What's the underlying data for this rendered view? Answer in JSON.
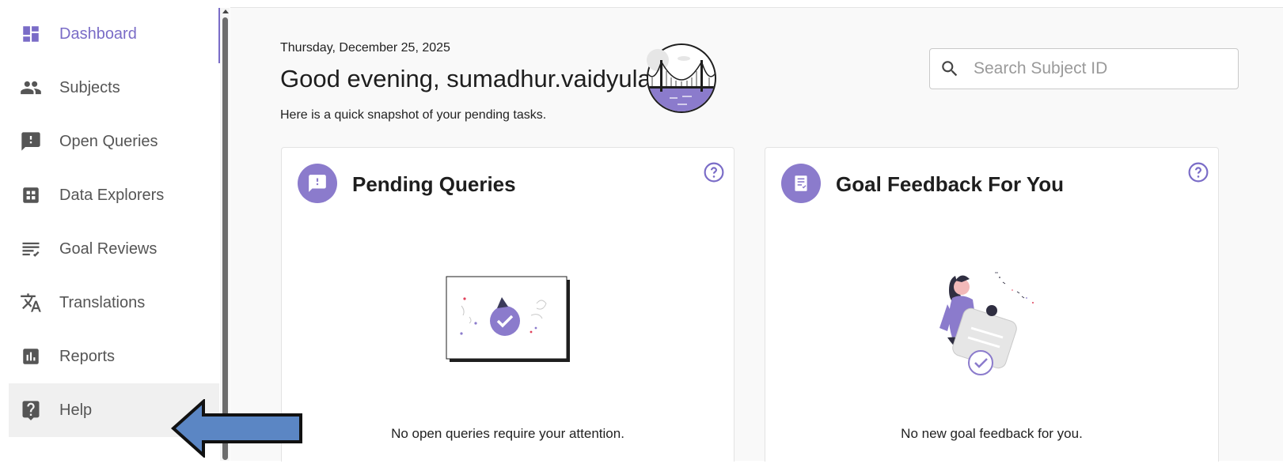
{
  "sidebar": {
    "items": [
      {
        "label": "Dashboard",
        "icon": "dashboard-icon",
        "active": true
      },
      {
        "label": "Subjects",
        "icon": "people-icon"
      },
      {
        "label": "Open Queries",
        "icon": "feedback-icon"
      },
      {
        "label": "Data Explorers",
        "icon": "apps-icon"
      },
      {
        "label": "Goal Reviews",
        "icon": "checklist-icon"
      },
      {
        "label": "Translations",
        "icon": "translate-icon"
      },
      {
        "label": "Reports",
        "icon": "bar-chart-icon"
      },
      {
        "label": "Help",
        "icon": "help-square-icon"
      }
    ]
  },
  "header": {
    "date": "Thursday, December 25, 2025",
    "greeting": "Good evening, sumadhur.vaidyula",
    "snapshot": "Here is a quick snapshot of your pending tasks."
  },
  "search": {
    "placeholder": "Search Subject ID"
  },
  "cards": {
    "pending_queries": {
      "title": "Pending Queries",
      "empty_message": "No open queries require your attention."
    },
    "goal_feedback": {
      "title": "Goal Feedback For You",
      "empty_message": "No new goal feedback for you."
    }
  },
  "colors": {
    "accent": "#7a6cc7",
    "badge": "#8b7bcc",
    "overlay_arrow": "#5b86c4"
  }
}
